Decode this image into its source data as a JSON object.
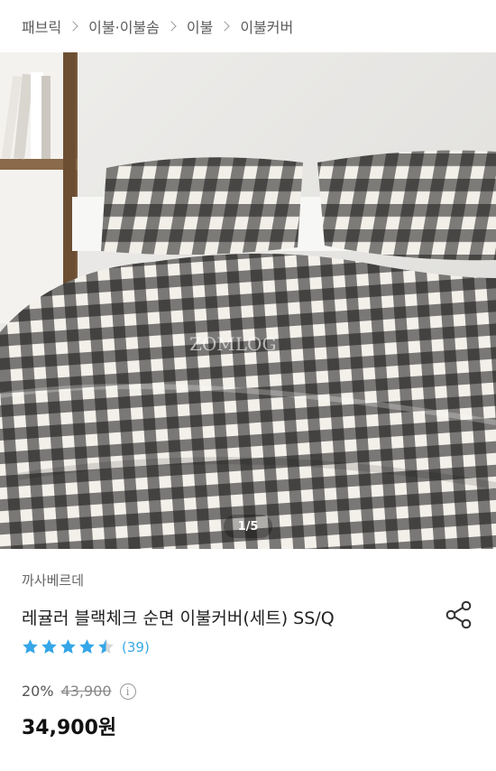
{
  "breadcrumb": [
    "패브릭",
    "이불·이불솜",
    "이불",
    "이불커버"
  ],
  "gallery": {
    "counter": "1/5",
    "watermark": "ZOMLOG",
    "current": 1,
    "total": 5
  },
  "product": {
    "brand": "까사베르데",
    "title": "레귤러 블랙체크 순면 이불커버(세트) SS/Q",
    "rating": 4.5,
    "review_count": "(39)",
    "discount": "20%",
    "original_price": "43,900",
    "info_icon": "i",
    "price": "34,900원"
  },
  "colors": {
    "accent_blue": "#35a6e8",
    "star_empty": "#d7d7d7",
    "check_black": "#1b1b1b"
  },
  "icons": {
    "share": "share-icon",
    "star": "star-icon",
    "info": "info-icon"
  }
}
